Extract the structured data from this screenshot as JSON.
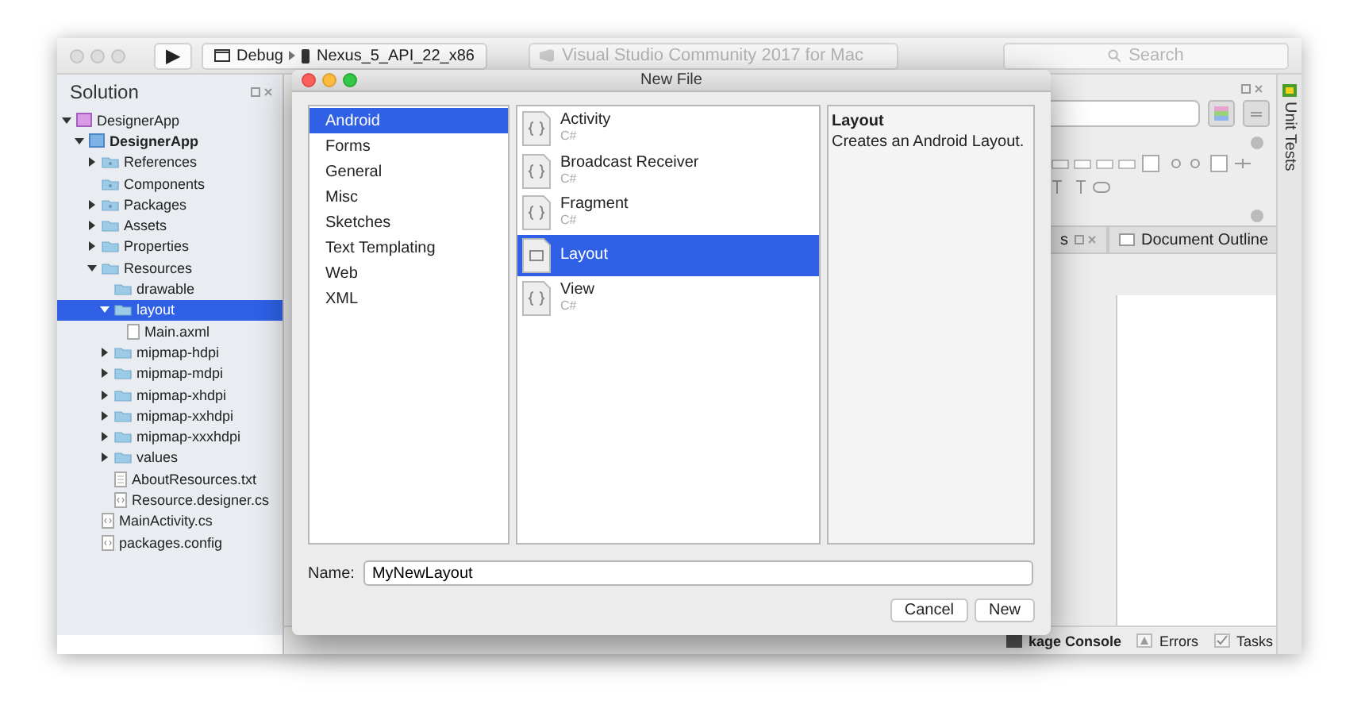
{
  "toolbar": {
    "run_label": "▶",
    "configuration": "Debug",
    "device": "Nexus_5_API_22_x86",
    "title": "Visual Studio Community 2017 for Mac",
    "search": {
      "placeholder": "Search"
    }
  },
  "solution_pad": {
    "title": "Solution",
    "tree": [
      {
        "label": "DesignerApp",
        "kind": "solution",
        "expanded": true,
        "selected": false,
        "children": [
          {
            "label": "DesignerApp",
            "kind": "project",
            "expanded": true,
            "selected": false,
            "children": [
              {
                "label": "References",
                "kind": "special-folder",
                "expanded": false,
                "selected": false
              },
              {
                "label": "Components",
                "kind": "special-folder",
                "selected": false
              },
              {
                "label": "Packages",
                "kind": "special-folder",
                "expanded": false,
                "selected": false
              },
              {
                "label": "Assets",
                "kind": "folder",
                "expanded": false,
                "selected": false
              },
              {
                "label": "Properties",
                "kind": "folder",
                "expanded": false,
                "selected": false
              },
              {
                "label": "Resources",
                "kind": "folder",
                "expanded": true,
                "selected": false,
                "children": [
                  {
                    "label": "drawable",
                    "kind": "folder",
                    "selected": false
                  },
                  {
                    "label": "layout",
                    "kind": "folder",
                    "expanded": true,
                    "selected": true,
                    "children": [
                      {
                        "label": "Main.axml",
                        "kind": "file",
                        "selected": false
                      }
                    ]
                  },
                  {
                    "label": "mipmap-hdpi",
                    "kind": "folder",
                    "expanded": false,
                    "selected": false
                  },
                  {
                    "label": "mipmap-mdpi",
                    "kind": "folder",
                    "expanded": false,
                    "selected": false
                  },
                  {
                    "label": "mipmap-xhdpi",
                    "kind": "folder",
                    "expanded": false,
                    "selected": false
                  },
                  {
                    "label": "mipmap-xxhdpi",
                    "kind": "folder",
                    "expanded": false,
                    "selected": false
                  },
                  {
                    "label": "mipmap-xxxhdpi",
                    "kind": "folder",
                    "expanded": false,
                    "selected": false
                  },
                  {
                    "label": "values",
                    "kind": "folder",
                    "expanded": false,
                    "selected": false
                  },
                  {
                    "label": "AboutResources.txt",
                    "kind": "text-file",
                    "selected": false
                  },
                  {
                    "label": "Resource.designer.cs",
                    "kind": "code-file",
                    "selected": false
                  }
                ]
              },
              {
                "label": "MainActivity.cs",
                "kind": "code-file",
                "selected": false
              },
              {
                "label": "packages.config",
                "kind": "code-file",
                "selected": false
              }
            ]
          }
        ]
      }
    ]
  },
  "designer_pad": {
    "tabs": [
      {
        "label": "s",
        "selected": false
      },
      {
        "label": "Document Outline",
        "selected": false
      }
    ]
  },
  "side_strip": {
    "label": "Unit Tests"
  },
  "status_bar": [
    {
      "label": "kage Console",
      "kind": "console"
    },
    {
      "label": "Errors",
      "kind": "errors"
    },
    {
      "label": "Tasks",
      "kind": "tasks"
    }
  ],
  "dialog": {
    "title": "New File",
    "categories": [
      {
        "label": "Android",
        "selected": true
      },
      {
        "label": "Forms",
        "selected": false
      },
      {
        "label": "General",
        "selected": false
      },
      {
        "label": "Misc",
        "selected": false
      },
      {
        "label": "Sketches",
        "selected": false
      },
      {
        "label": "Text Templating",
        "selected": false
      },
      {
        "label": "Web",
        "selected": false
      },
      {
        "label": "XML",
        "selected": false
      }
    ],
    "templates": [
      {
        "name": "Activity",
        "subtitle": "C#",
        "kind": "code",
        "selected": false
      },
      {
        "name": "Broadcast Receiver",
        "subtitle": "C#",
        "kind": "code",
        "selected": false
      },
      {
        "name": "Fragment",
        "subtitle": "C#",
        "kind": "code",
        "selected": false
      },
      {
        "name": "Layout",
        "kind": "layout",
        "selected": true
      },
      {
        "name": "View",
        "subtitle": "C#",
        "kind": "code",
        "selected": false
      }
    ],
    "description": {
      "title": "Layout",
      "text": "Creates an Android Layout."
    },
    "name_label": "Name:",
    "name_value": "MyNewLayout",
    "buttons": [
      {
        "label": "Cancel",
        "default": false
      },
      {
        "label": "New",
        "default": false
      }
    ]
  }
}
